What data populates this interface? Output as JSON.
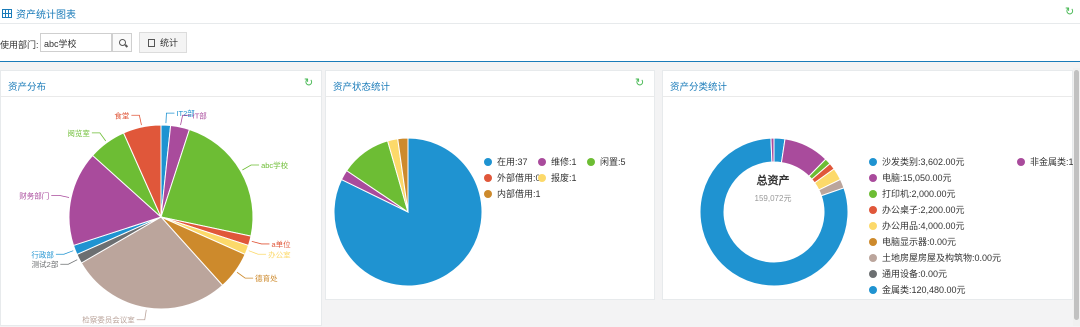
{
  "header": {
    "title": "资产统计图表"
  },
  "toolbar": {
    "dept_label": "使用部门:",
    "dept_value": "abc学校",
    "stat_label": "统计"
  },
  "panels": {
    "distribution": {
      "title": "资产分布"
    },
    "status": {
      "title": "资产状态统计"
    },
    "category": {
      "title": "资产分类统计",
      "center_title": "总资产",
      "center_value": "159,072元"
    }
  },
  "chart_data": [
    {
      "type": "pie",
      "title": "资产分布",
      "slices": [
        {
          "label": "IT2部",
          "value": 1,
          "color": "#1f93d1"
        },
        {
          "label": "IT部",
          "value": 2,
          "color": "#a94b9c"
        },
        {
          "label": "abc学校",
          "value": 14,
          "color": "#6dbd34"
        },
        {
          "label": "a单位",
          "value": 1,
          "color": "#e0573a"
        },
        {
          "label": "办公室",
          "value": 1,
          "color": "#fcd96a"
        },
        {
          "label": "德育处",
          "value": 4,
          "color": "#cd8a2c"
        },
        {
          "label": "检察委员会议室",
          "value": 17,
          "color": "#bba59c"
        },
        {
          "label": "测试2部",
          "value": 1,
          "color": "#6c6f71"
        },
        {
          "label": "行政部",
          "value": 1,
          "color": "#1f93d1"
        },
        {
          "label": "财务部门",
          "value": 10,
          "color": "#a94b9c"
        },
        {
          "label": "阅览室",
          "value": 4,
          "color": "#6dbd34"
        },
        {
          "label": "食堂",
          "value": 4,
          "color": "#e0573a"
        }
      ]
    },
    {
      "type": "pie",
      "title": "资产状态统计",
      "slices": [
        {
          "label": "在用",
          "value": 37,
          "color": "#1f93d1"
        },
        {
          "label": "维修",
          "value": 1,
          "color": "#a94b9c"
        },
        {
          "label": "闲置",
          "value": 5,
          "color": "#6dbd34"
        },
        {
          "label": "外部借用",
          "value": 0,
          "color": "#e0573a"
        },
        {
          "label": "报废",
          "value": 1,
          "color": "#fcd96a"
        },
        {
          "label": "内部借用",
          "value": 1,
          "color": "#cd8a2c"
        }
      ],
      "legend": [
        "在用:37",
        "维修:1",
        "闲置:5",
        "外部借用:0",
        "报废:1",
        "内部借用:1"
      ]
    },
    {
      "type": "pie",
      "title": "资产分类统计",
      "slices": [
        {
          "label": "沙发类别",
          "value": 3602,
          "color": "#1f93d1"
        },
        {
          "label": "电脑",
          "value": 15050,
          "color": "#a94b9c"
        },
        {
          "label": "打印机",
          "value": 2000,
          "color": "#6dbd34"
        },
        {
          "label": "办公桌子",
          "value": 2200,
          "color": "#e0573a"
        },
        {
          "label": "办公用品",
          "value": 4000,
          "color": "#fcd96a"
        },
        {
          "label": "电脑显示器",
          "value": 0,
          "color": "#cd8a2c"
        },
        {
          "label": "土地房屋房屋及构筑物",
          "value": 3000,
          "color": "#bba59c"
        },
        {
          "label": "通用设备",
          "value": 0,
          "color": "#6c6f71"
        },
        {
          "label": "金属类",
          "value": 120480,
          "color": "#1f93d1"
        },
        {
          "label": "非金属类",
          "value": 1000,
          "color": "#a94b9c"
        }
      ],
      "legend": [
        "沙发类别:3,602.00元",
        "电脑:15,050.00元",
        "打印机:2,000.00元",
        "办公桌子:2,200.00元",
        "办公用品:4,000.00元",
        "电脑显示器:0.00元",
        "土地房屋房屋及构筑物:0.00元",
        "通用设备:0.00元",
        "金属类:120,480.00元",
        "非金属类:1"
      ]
    }
  ]
}
